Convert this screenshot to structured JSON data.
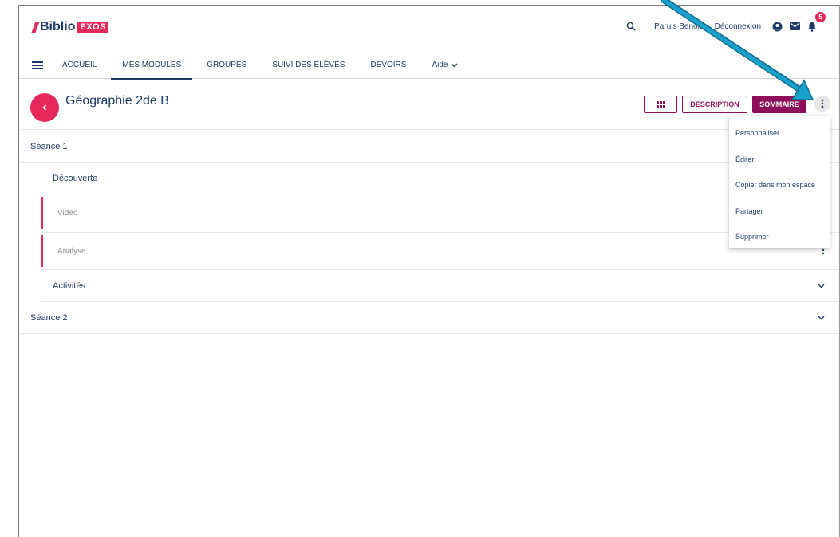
{
  "header": {
    "logo_main": "Biblio",
    "logo_badge": "EXOS",
    "user_name": "Paruis Benoit",
    "logout_label": "Déconnexion",
    "notification_count": "5"
  },
  "nav": {
    "items": [
      {
        "label": "ACCUEIL"
      },
      {
        "label": "MES MODULES"
      },
      {
        "label": "GROUPES"
      },
      {
        "label": "SUIVI DES ÉLÈVES"
      },
      {
        "label": "DEVOIRS"
      },
      {
        "label": "Aide"
      }
    ]
  },
  "module": {
    "title": "Géographie 2de B",
    "description_label": "DESCRIPTION",
    "summary_label": "SOMMAIRE"
  },
  "outline": {
    "seance1": "Séance 1",
    "decouverte": "Découverte",
    "video": "Vidéo",
    "analyse": "Analyse",
    "activites": "Activités",
    "seance2": "Séance 2"
  },
  "menu": {
    "items": [
      {
        "label": "Personnaliser"
      },
      {
        "label": "Éditer"
      },
      {
        "label": "Copier dans mon espace"
      },
      {
        "label": "Partager"
      },
      {
        "label": "Supprimer"
      }
    ]
  },
  "colors": {
    "accent_pink": "#e6285a",
    "brand_purple": "#8f0e59",
    "text_navy": "#1d3b68",
    "annotation_arrow": "#1aa1c9"
  }
}
